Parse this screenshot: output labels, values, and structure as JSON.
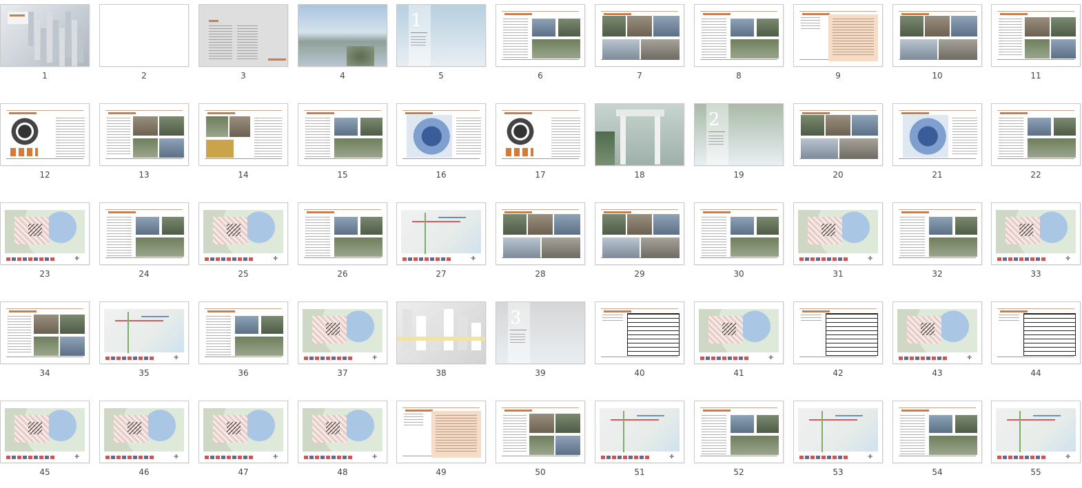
{
  "thumbnails": [
    {
      "number": "1",
      "kind": "city-cover"
    },
    {
      "number": "2",
      "kind": "blank"
    },
    {
      "number": "3",
      "kind": "toc"
    },
    {
      "number": "4",
      "kind": "mountain-photo"
    },
    {
      "number": "5",
      "kind": "section-cover",
      "section": "1",
      "bg": "#b7cfe0"
    },
    {
      "number": "6",
      "kind": "text-photo-right"
    },
    {
      "number": "7",
      "kind": "photo-grid"
    },
    {
      "number": "8",
      "kind": "text-photo-right"
    },
    {
      "number": "9",
      "kind": "peach-list"
    },
    {
      "number": "10",
      "kind": "photo-grid"
    },
    {
      "number": "11",
      "kind": "photo-grid-text"
    },
    {
      "number": "12",
      "kind": "diagram-text"
    },
    {
      "number": "13",
      "kind": "photo-grid-text"
    },
    {
      "number": "14",
      "kind": "text-photo-left"
    },
    {
      "number": "15",
      "kind": "text-photo-right"
    },
    {
      "number": "16",
      "kind": "map-text"
    },
    {
      "number": "17",
      "kind": "diagram-text"
    },
    {
      "number": "18",
      "kind": "gate-photo"
    },
    {
      "number": "19",
      "kind": "section-cover",
      "section": "2",
      "bg": "#a9bba8"
    },
    {
      "number": "20",
      "kind": "photo-grid"
    },
    {
      "number": "21",
      "kind": "map-text"
    },
    {
      "number": "22",
      "kind": "text-photo-right"
    },
    {
      "number": "23",
      "kind": "site-map"
    },
    {
      "number": "24",
      "kind": "text-photo-right"
    },
    {
      "number": "25",
      "kind": "site-map"
    },
    {
      "number": "26",
      "kind": "text-photo-right"
    },
    {
      "number": "27",
      "kind": "site-map-light"
    },
    {
      "number": "28",
      "kind": "photo-grid"
    },
    {
      "number": "29",
      "kind": "photo-grid"
    },
    {
      "number": "30",
      "kind": "text-photo-right"
    },
    {
      "number": "31",
      "kind": "site-map"
    },
    {
      "number": "32",
      "kind": "text-photo-right"
    },
    {
      "number": "33",
      "kind": "site-map"
    },
    {
      "number": "34",
      "kind": "photo-grid-text"
    },
    {
      "number": "35",
      "kind": "site-map-light"
    },
    {
      "number": "36",
      "kind": "text-photo-right"
    },
    {
      "number": "37",
      "kind": "site-map"
    },
    {
      "number": "38",
      "kind": "city-3d"
    },
    {
      "number": "39",
      "kind": "section-cover",
      "section": "3",
      "bg": "#d6d6d6"
    },
    {
      "number": "40",
      "kind": "table"
    },
    {
      "number": "41",
      "kind": "site-map"
    },
    {
      "number": "42",
      "kind": "table"
    },
    {
      "number": "43",
      "kind": "site-map"
    },
    {
      "number": "44",
      "kind": "table"
    },
    {
      "number": "45",
      "kind": "site-map"
    },
    {
      "number": "46",
      "kind": "site-map"
    },
    {
      "number": "47",
      "kind": "site-map"
    },
    {
      "number": "48",
      "kind": "site-map"
    },
    {
      "number": "49",
      "kind": "peach-list"
    },
    {
      "number": "50",
      "kind": "photo-grid-text"
    },
    {
      "number": "51",
      "kind": "site-map-light"
    },
    {
      "number": "52",
      "kind": "text-photo-right"
    },
    {
      "number": "53",
      "kind": "site-map-light"
    },
    {
      "number": "54",
      "kind": "text-photo-right"
    },
    {
      "number": "55",
      "kind": "site-map-light"
    }
  ],
  "colors": {
    "accent": "#d47a3a",
    "peach": "#f6dcc6",
    "label": "#444444",
    "border": "#c9c9c9"
  }
}
